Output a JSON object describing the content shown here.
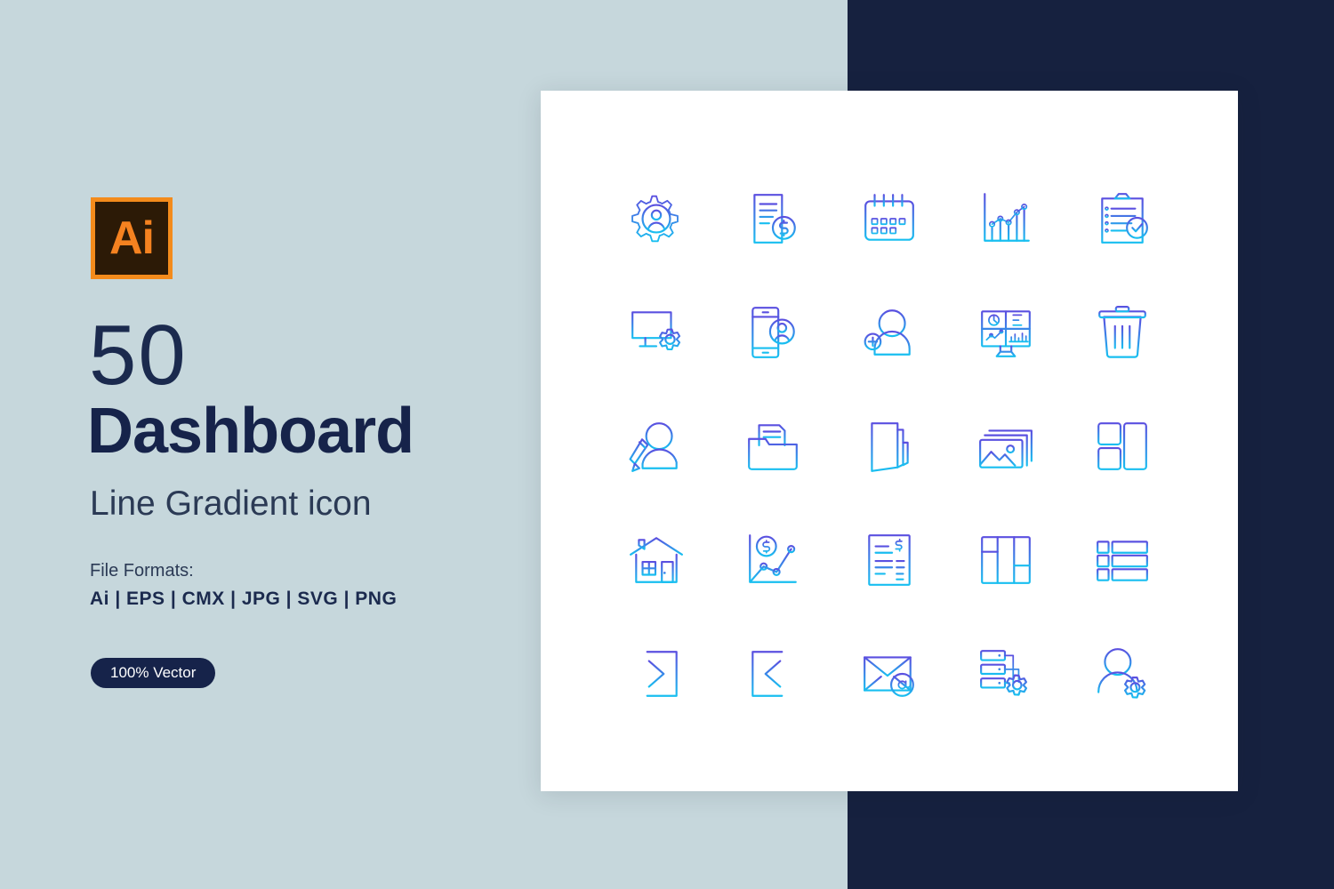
{
  "palette": {
    "page_bg": "#c6d7dc",
    "dark_panel": "#16213f",
    "card_bg": "#ffffff",
    "heading": "#16234a",
    "gradient_top": "#5b4fe0",
    "gradient_bottom": "#18bff0",
    "badge_border": "#f38b1c",
    "badge_fill": "#2c1a06",
    "badge_text": "#f58220"
  },
  "left": {
    "badge_label": "Ai",
    "count": "50",
    "title": "Dashboard",
    "subtitle": "Line Gradient icon",
    "formats_label": "File Formats:",
    "formats_list": "Ai  |  EPS  |  CMX  |  JPG  |  SVG  |  PNG",
    "vector_pill": "100% Vector"
  },
  "icons": [
    {
      "name": "user-settings-gear-icon",
      "label": "User Settings"
    },
    {
      "name": "invoice-document-dollar-icon",
      "label": "Invoice"
    },
    {
      "name": "calendar-icon",
      "label": "Calendar"
    },
    {
      "name": "bar-line-chart-icon",
      "label": "Analytics Chart"
    },
    {
      "name": "clipboard-check-icon",
      "label": "Task Checklist"
    },
    {
      "name": "monitor-settings-icon",
      "label": "Desktop Settings"
    },
    {
      "name": "mobile-user-profile-icon",
      "label": "Mobile Profile"
    },
    {
      "name": "add-user-icon",
      "label": "Add User"
    },
    {
      "name": "dashboard-monitor-icon",
      "label": "Dashboard Screen"
    },
    {
      "name": "trash-bin-icon",
      "label": "Delete"
    },
    {
      "name": "edit-profile-pencil-icon",
      "label": "Edit Profile"
    },
    {
      "name": "open-folder-documents-icon",
      "label": "Documents Folder"
    },
    {
      "name": "closed-folder-icon",
      "label": "Folder"
    },
    {
      "name": "image-gallery-icon",
      "label": "Gallery"
    },
    {
      "name": "layout-grid-icon",
      "label": "Layout Grid"
    },
    {
      "name": "home-house-icon",
      "label": "Home"
    },
    {
      "name": "revenue-growth-chart-icon",
      "label": "Revenue Chart"
    },
    {
      "name": "billing-statement-icon",
      "label": "Billing Statement"
    },
    {
      "name": "columns-layout-icon",
      "label": "Columns Layout"
    },
    {
      "name": "list-rows-layout-icon",
      "label": "List Layout"
    },
    {
      "name": "login-icon",
      "label": "Login"
    },
    {
      "name": "logout-icon",
      "label": "Logout"
    },
    {
      "name": "email-at-icon",
      "label": "Email"
    },
    {
      "name": "server-settings-icon",
      "label": "Server Settings"
    },
    {
      "name": "user-account-settings-icon",
      "label": "Account Settings"
    }
  ]
}
